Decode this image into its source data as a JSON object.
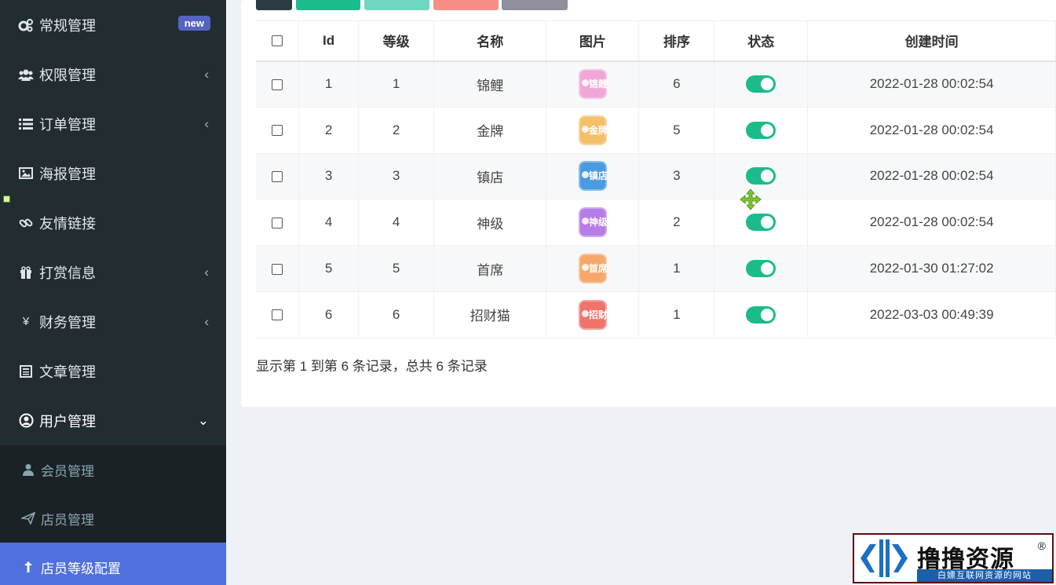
{
  "sidebar": {
    "items": [
      {
        "label": "常规管理",
        "icon": "gears-icon",
        "badge": "new"
      },
      {
        "label": "权限管理",
        "icon": "users-icon",
        "chevron": "‹"
      },
      {
        "label": "订单管理",
        "icon": "list-icon",
        "chevron": "‹"
      },
      {
        "label": "海报管理",
        "icon": "image-icon"
      },
      {
        "label": "友情链接",
        "icon": "link-icon"
      },
      {
        "label": "打赏信息",
        "icon": "gift-icon",
        "chevron": "‹"
      },
      {
        "label": "财务管理",
        "icon": "yen-icon",
        "glyph": "¥",
        "chevron": "‹"
      },
      {
        "label": "文章管理",
        "icon": "newspaper-icon"
      },
      {
        "label": "用户管理",
        "icon": "user-circle-icon",
        "chevron": "⌄"
      }
    ],
    "sub_items": [
      {
        "label": "会员管理",
        "icon": "user-icon"
      },
      {
        "label": "店员管理",
        "icon": "paper-plane-icon"
      },
      {
        "label": "店员等级配置",
        "icon": "level-up-icon",
        "active": true
      }
    ]
  },
  "toolbar": {
    "buttons": [
      {
        "name": "refresh-button",
        "color": "#2c3b41"
      },
      {
        "name": "add-button",
        "color": "#1cbb8c"
      },
      {
        "name": "edit-button",
        "color": "#6fd6c0"
      },
      {
        "name": "delete-button",
        "color": "#f78e86"
      },
      {
        "name": "more-button",
        "color": "#8d8f99"
      }
    ]
  },
  "table": {
    "headers": [
      "Id",
      "等级",
      "名称",
      "图片",
      "排序",
      "状态",
      "创建时间"
    ],
    "rows": [
      {
        "id": "1",
        "level": "1",
        "name": "锦鲤",
        "medal_text": "锦鲤",
        "medal_color": "#f1a6d8",
        "sort": "6",
        "status": true,
        "created": "2022-01-28 00:02:54"
      },
      {
        "id": "2",
        "level": "2",
        "name": "金牌",
        "medal_text": "金牌",
        "medal_color": "#f4c06a",
        "sort": "5",
        "status": true,
        "created": "2022-01-28 00:02:54"
      },
      {
        "id": "3",
        "level": "3",
        "name": "镇店",
        "medal_text": "镇店",
        "medal_color": "#4b9be0",
        "sort": "3",
        "status": true,
        "created": "2022-01-28 00:02:54"
      },
      {
        "id": "4",
        "level": "4",
        "name": "神级",
        "medal_text": "神级",
        "medal_color": "#b57de6",
        "sort": "2",
        "status": true,
        "created": "2022-01-28 00:02:54"
      },
      {
        "id": "5",
        "level": "5",
        "name": "首席",
        "medal_text": "首席",
        "medal_color": "#f6a86b",
        "sort": "1",
        "status": true,
        "created": "2022-01-30 01:27:02"
      },
      {
        "id": "6",
        "level": "6",
        "name": "招财猫",
        "medal_text": "招财猫",
        "medal_color": "#f0746b",
        "sort": "1",
        "status": true,
        "created": "2022-03-03 00:49:39"
      }
    ],
    "summary": "显示第 1 到第 6 条记录，总共 6 条记录"
  },
  "watermark": {
    "title": "撸撸资源",
    "reg": "®",
    "subtitle": "白嫖互联网资源的网站"
  }
}
